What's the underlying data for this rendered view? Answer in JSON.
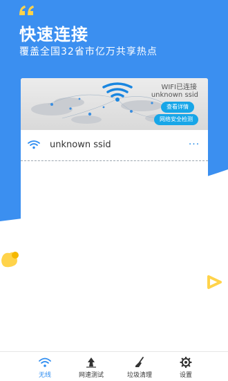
{
  "hero": {
    "title": "快速连接",
    "subtitle": "覆盖全国32省市亿万共享热点"
  },
  "banner": {
    "status": "WIFI已连接",
    "ssid": "unknown ssid",
    "detail_button": "查看详情",
    "security_button": "网络安全检测"
  },
  "wifi_list": [
    {
      "name": "unknown ssid",
      "more": "···"
    }
  ],
  "tabs": [
    {
      "label": "无线",
      "icon": "wifi-icon",
      "active": true
    },
    {
      "label": "网速测试",
      "icon": "speed-test-icon",
      "active": false
    },
    {
      "label": "垃圾清理",
      "icon": "broom-icon",
      "active": false
    },
    {
      "label": "设置",
      "icon": "gear-icon",
      "active": false
    }
  ],
  "colors": {
    "primary": "#3b8ff0",
    "accent_yellow": "#ffd34a",
    "button_blue": "#17a6e8",
    "tab_active": "#2d8cf0"
  }
}
